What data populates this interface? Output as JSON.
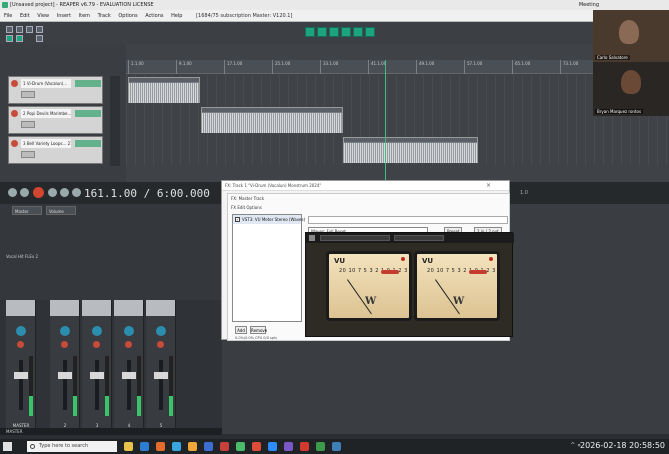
{
  "window": {
    "title": "[Unsaved project] - REAPER v6.79 - EVALUATION LICENSE",
    "session": "Meeting"
  },
  "menu": {
    "items": [
      "File",
      "Edit",
      "View",
      "Insert",
      "Item",
      "Track",
      "Options",
      "Actions",
      "Help"
    ],
    "project_label": "[1684/75 subscription Master: V120.1]"
  },
  "tracks": [
    {
      "name": "1 Vi-Drum (Vacalun)...",
      "sub": "trim"
    },
    {
      "name": "2 Popi Devils Marimbe... 2144",
      "sub": "trim"
    },
    {
      "name": "3 Bell Variety Loops... 2140",
      "sub": "trim"
    }
  ],
  "ruler": {
    "ticks": [
      "1.1.00",
      "9.1.00",
      "17.1.00",
      "25.1.00",
      "33.1.00",
      "41.1.00",
      "49.1.00",
      "57.1.00",
      "65.1.00",
      "73.1.00",
      "81.1.00"
    ]
  },
  "clips": [
    {
      "label": "Vi-Drum-Vacalun"
    },
    {
      "label": "Popi Devils Marimbe"
    },
    {
      "label": "Bell Variety Loops"
    }
  ],
  "transport": {
    "time": "161.1.00 / 6:00.000",
    "rate": "1.0"
  },
  "mixer": {
    "buttons": [
      "Master",
      "Volume",
      "Mute"
    ],
    "track_label": "Vocal Hit FLEx 2",
    "strips": [
      {
        "name": "MASTER"
      },
      {
        "name": "2"
      },
      {
        "name": "3"
      },
      {
        "name": "4"
      },
      {
        "name": "5"
      }
    ],
    "footer": "MASTER"
  },
  "fx": {
    "window_title": "FX: Track 1 \"Vi-Drum (Vacalun) Monstrum 2024\"",
    "inner_title": "FX: Master Track",
    "menu": "FX   Edit   Options",
    "chain": [
      {
        "name": "VST3: VU Meter Stereo (Waves)",
        "checked": true
      }
    ],
    "preset": "Waves: Full Reset",
    "preset_btn": "Preset",
    "param_btn": "2 in / 2 out",
    "add": "Add",
    "remove": "Remove",
    "cpu": "0.0%/0.0% CPU 0/0 spls"
  },
  "vu": {
    "left": {
      "label": "VU",
      "scale": "20 10 7 5 3 2 1 0 1 2 3"
    },
    "right": {
      "label": "VU",
      "scale": "20 10 7 5 3 2 1 0 1 2 3"
    },
    "brand": "W"
  },
  "video": {
    "participant1": "Carlo Salvatore",
    "participant2": "Bryan Marquez rontos"
  },
  "taskbar": {
    "search": "Type here to search",
    "time": "2026-02-18  20:58:50",
    "tray": "^  ⋄"
  },
  "colors": {
    "accent": "#1fa37e",
    "record": "#d3452f",
    "playhead": "#3fbf7f"
  }
}
